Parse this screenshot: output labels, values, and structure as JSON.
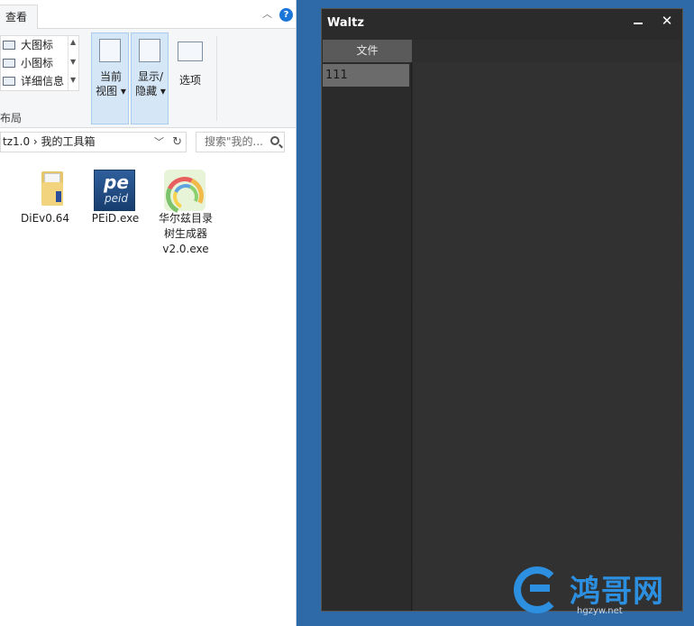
{
  "explorer": {
    "ribbon_tab": "查看",
    "layout_items": [
      "大图标",
      "小图标",
      "详细信息"
    ],
    "layout_group_label": "布局",
    "current_view_label_1": "当前",
    "current_view_label_2": "视图",
    "show_hide_label_1": "显示/",
    "show_hide_label_2": "隐藏",
    "options_label": "选项",
    "address_text": "tz1.0 › 我的工具箱",
    "search_placeholder": "搜索\"我的...",
    "files": [
      {
        "name_1": "DiEv0.64",
        "name_2": "",
        "name_3": ""
      },
      {
        "name_1": "PEiD.exe",
        "name_2": "",
        "name_3": ""
      },
      {
        "name_1": "华尔兹目录",
        "name_2": "树生成器",
        "name_3": "v2.0.exe"
      }
    ],
    "peid_icon_text": "pe",
    "peid_icon_sub": "peid"
  },
  "waltz": {
    "title": "Waltz",
    "menu_file": "文件",
    "list_item": "111"
  },
  "watermark": {
    "text": "鸿哥网",
    "sub": "hgzyw.net"
  },
  "colors": {
    "desktop": "#2f6aa8",
    "waltz_bg": "#2a2a2a",
    "accent": "#2c8fe0"
  }
}
